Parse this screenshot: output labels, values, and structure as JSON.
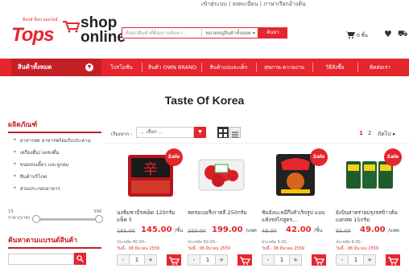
{
  "header": {
    "top_links": "เข้าสู่ระบบ | ลงทะเบียน | ภาษาเรียกอ้างต้น",
    "logo_tops": "Tops",
    "logo_tagline": "ท็อปส์ ช็อป ออนไลน์",
    "logo_shop": "shop",
    "logo_online": "online",
    "search_placeholder": "ค้นหาสินค้าที่ต้องการค้นหา...",
    "search_category": "หมวดหมู่สินค้าทั้งหมด ▾",
    "search_button": "ค้นหา",
    "cart_count": "0 ชิ้น"
  },
  "nav": {
    "all_products": "สินค้าทั้งหมด",
    "items": [
      "โปรโมชั่น",
      "สินค้า OWN BRAND",
      "สินค้าแม่และเด็ก",
      "สุขภาพ-ความงาม",
      "วิธีสั่งซื้อ",
      "ติดต่อเรา"
    ]
  },
  "page": {
    "title": "Taste Of Korea"
  },
  "sidebar": {
    "heading": "ผลิตภัณฑ์",
    "items": [
      "อาหารสด อาหารพร้อมรับประทาน",
      "เครื่องดื่ม/ ผงชงดื่ม",
      "ขนมขบเคี้ยว และลูกอม",
      "สินค้าบริโภค",
      "ส่วนประกอบอาหาร"
    ],
    "price_min": "15",
    "price_max": "390",
    "price_label": "ราคา(บาท)",
    "brand_heading": "ค้นหาตามแบรนด์สินค้า",
    "brand_placeholder": ""
  },
  "toolbar": {
    "sort_label": "เรียงจาก :",
    "sort_value": "... เลือก ...",
    "pages": [
      "1",
      "2"
    ],
    "next_label": "ถัดไป ▸"
  },
  "products": [
    {
      "name": "นงชิมชาบีรสเผ็ด 120กรัม แพ็ค 5",
      "old_price": "185.00",
      "new_price": "145.00",
      "unit": "/ชิ้น",
      "dept": "ประหยัด 40.00.-",
      "valid": "วันนี้ - 08 มีนาคม 2559",
      "qty": "1",
      "sale": "Sale"
    },
    {
      "name": "สตรอเบอรี่เกาหลี 250กรัม",
      "old_price": "259.00",
      "new_price": "199.00",
      "unit": "/แพค",
      "dept": "ประหยัด 60.00.-",
      "valid": "วันนี้ - 08 มีนาคม 2559",
      "qty": "1",
      "sale": ""
    },
    {
      "name": "ซัมยังบะหมี่กึ่งสำเร็จรูป แบบแห้งรสไก่สูตร...",
      "old_price": "48.00",
      "new_price": "42.00",
      "unit": "/ชิ้น",
      "dept": "ประหยัด 6.00.-",
      "valid": "วันนี้ - 08 มีนาคม 2559",
      "qty": "1",
      "sale": "Sale"
    },
    {
      "name": "ยังบินสาหร่ายปรุงรสข้าวต้ม แยกสด 15กรัม",
      "old_price": "55.00",
      "new_price": "49.00",
      "unit": "/แพค",
      "dept": "ประหยัด 6.00.-",
      "valid": "วันนี้ - 08 มีนาคม 2559",
      "qty": "1",
      "sale": "Sale"
    }
  ],
  "colors": {
    "brand_red": "#e5262d",
    "dark_red": "#c31f25"
  }
}
